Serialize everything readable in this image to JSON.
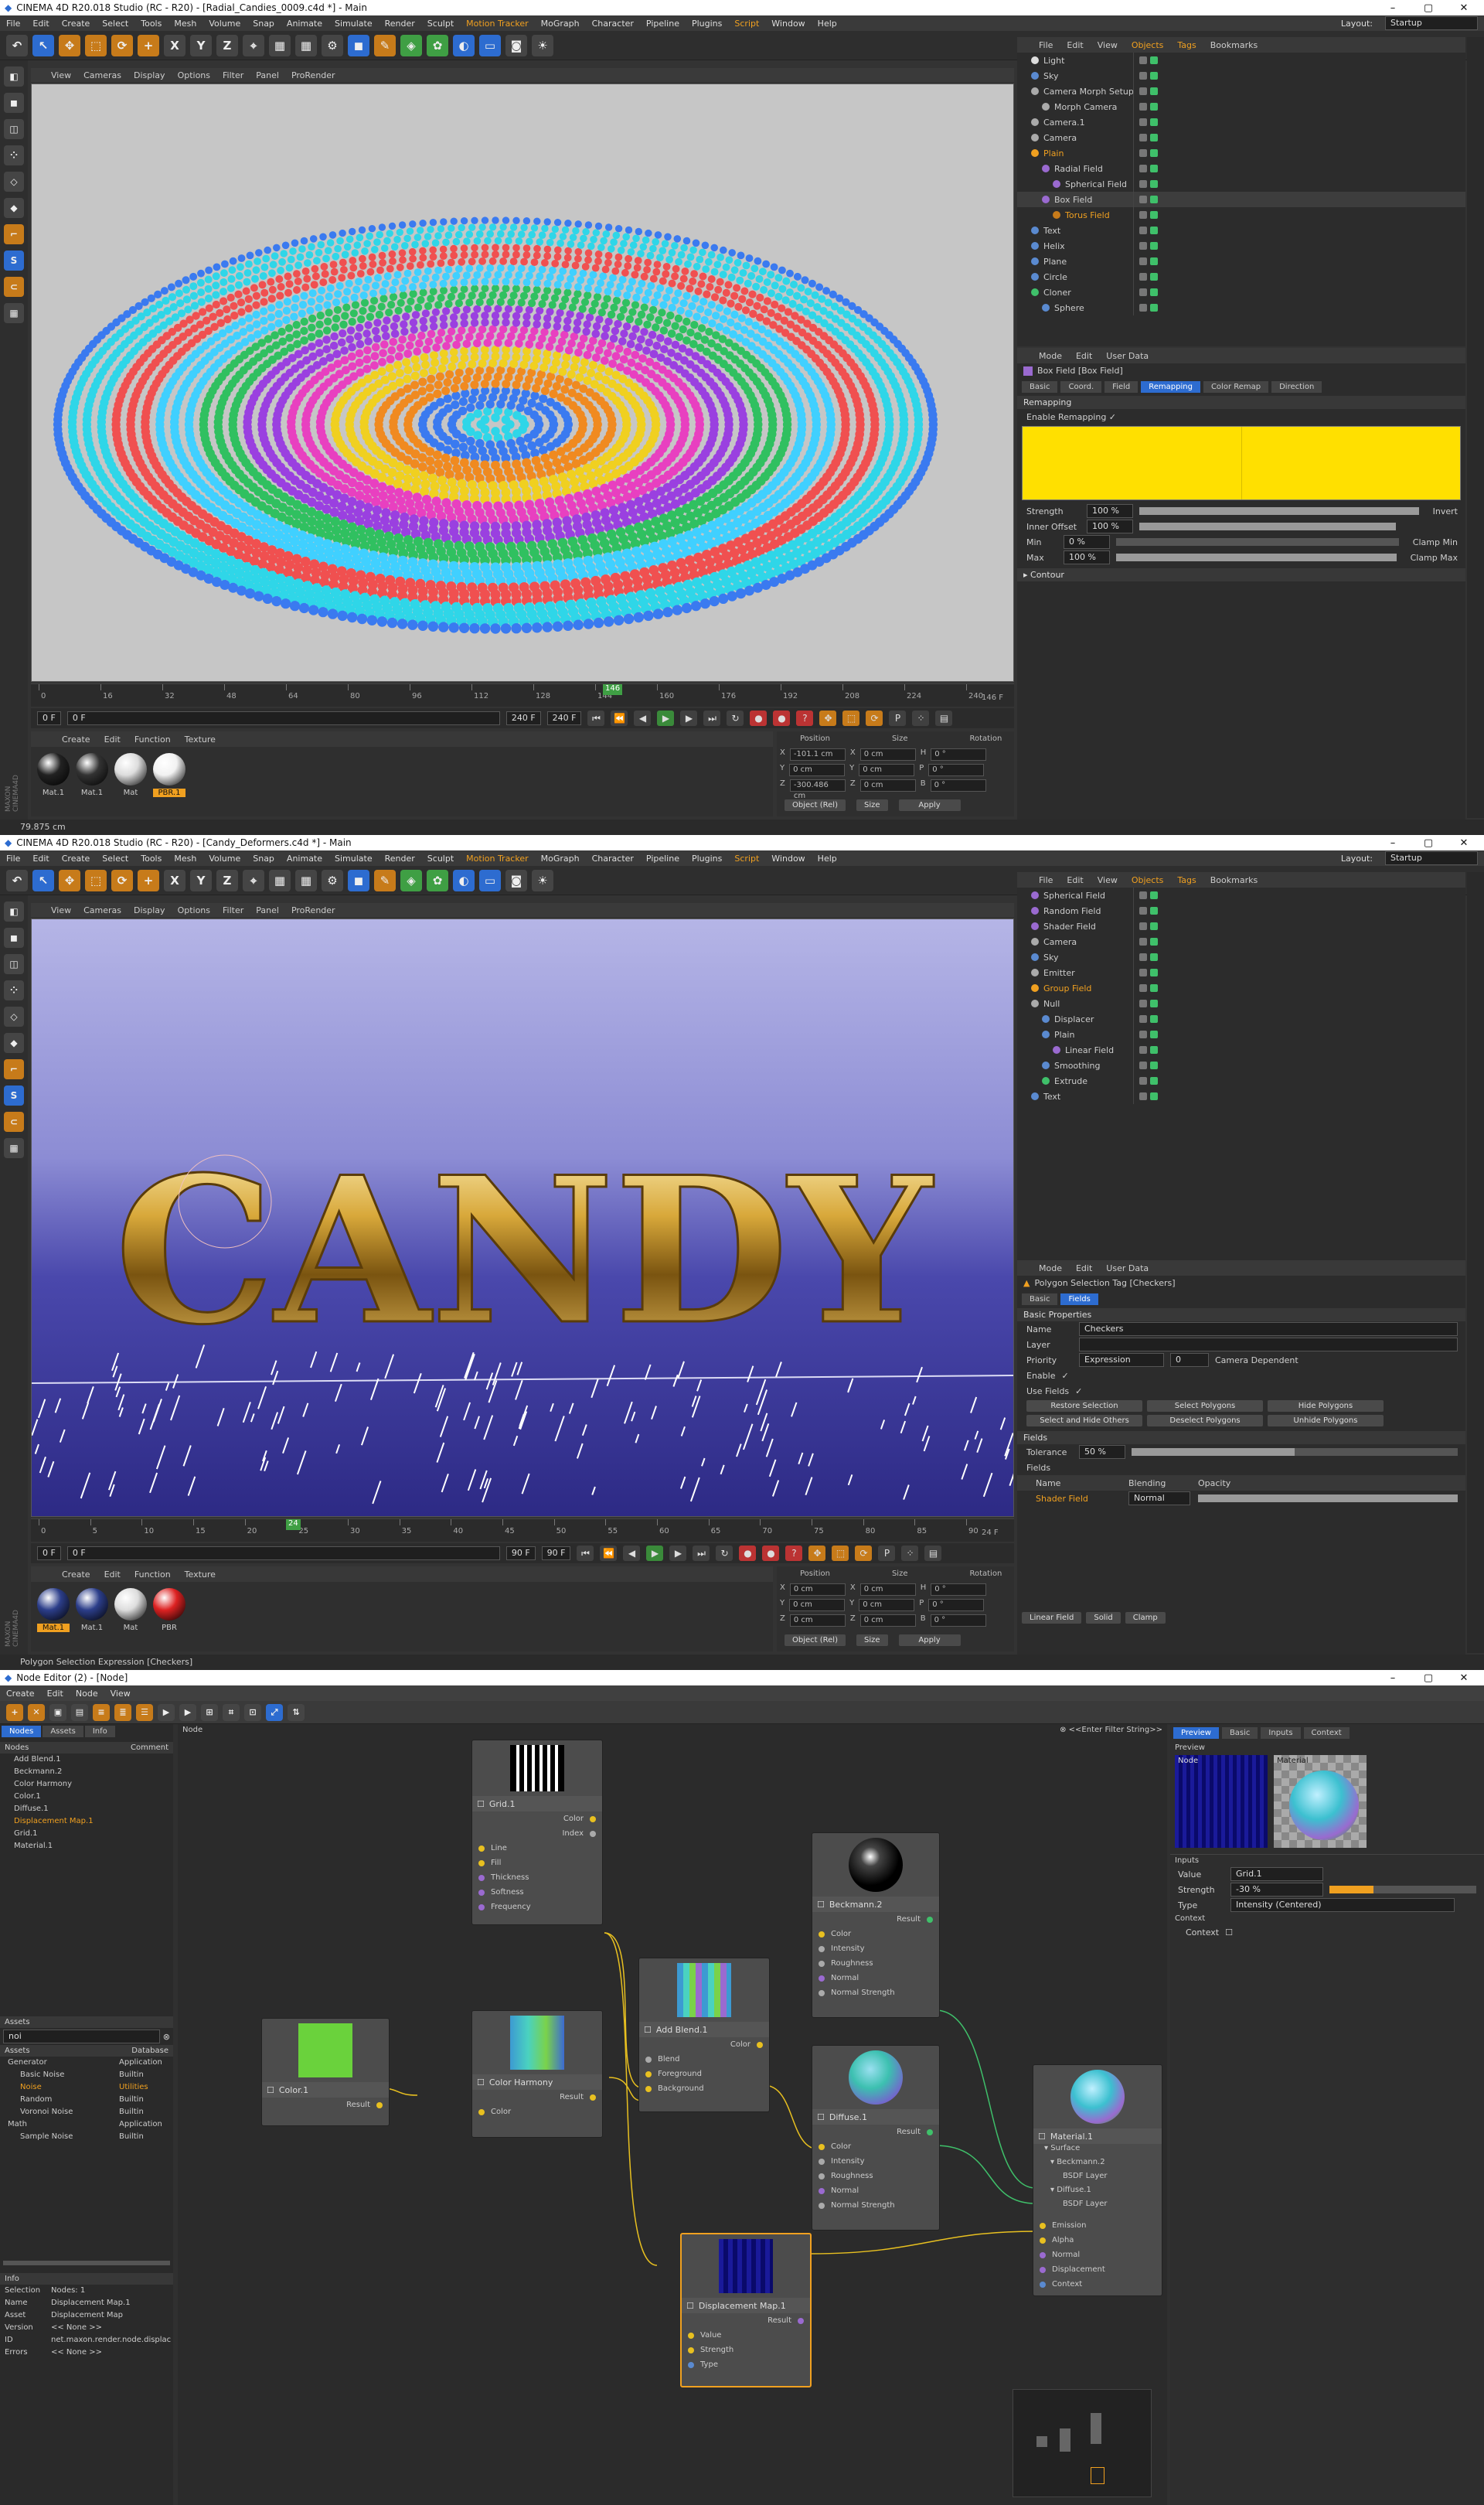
{
  "colors": {
    "accent": "#f0a020",
    "blue": "#2d6cd0",
    "bg": "#333333",
    "yellow_gradient": "#ffe000"
  },
  "win1": {
    "title": "CINEMA 4D R20.018 Studio (RC - R20) - [Radial_Candies_0009.c4d *] - Main",
    "layout_label": "Layout:",
    "layout_value": "Startup",
    "menu": [
      "File",
      "Edit",
      "Create",
      "Select",
      "Tools",
      "Mesh",
      "Volume",
      "Snap",
      "Animate",
      "Simulate",
      "Render",
      "Sculpt",
      "Motion Tracker",
      "MoGraph",
      "Character",
      "Pipeline",
      "Plugins",
      "Script",
      "Window",
      "Help"
    ],
    "vpmenu": [
      "View",
      "Cameras",
      "Display",
      "Options",
      "Filter",
      "Panel",
      "ProRender"
    ],
    "timeline_ticks": [
      "0",
      "16",
      "32",
      "48",
      "64",
      "80",
      "96",
      "112",
      "128",
      "144",
      "160",
      "176",
      "192",
      "208",
      "224",
      "240"
    ],
    "playhead": "146",
    "frame_end": "146 F",
    "frame_start": "0 F",
    "cur": "0 F",
    "max1": "240 F",
    "max2": "240 F",
    "mat_menu": [
      "Create",
      "Edit",
      "Function",
      "Texture"
    ],
    "materials": [
      {
        "label": "Mat.1",
        "color": "#222",
        "sel": false
      },
      {
        "label": "Mat.1",
        "color": "#333",
        "sel": false
      },
      {
        "label": "Mat",
        "color": "#ddd",
        "sel": false
      },
      {
        "label": "PBR.1",
        "color": "#f2f2f2",
        "sel": true
      }
    ],
    "coord_headers": [
      "Position",
      "Size",
      "Rotation"
    ],
    "coords": [
      [
        "X",
        "-101.1 cm",
        "X",
        "0 cm",
        "H",
        "0 °"
      ],
      [
        "Y",
        "0 cm",
        "Y",
        "0 cm",
        "P",
        "0 °"
      ],
      [
        "Z",
        "-300.486 cm",
        "Z",
        "0 cm",
        "B",
        "0 °"
      ]
    ],
    "coord_mode": "Object (Rel)",
    "coord_size": "Size",
    "apply": "Apply",
    "status": "79.875 cm",
    "obj_menu": [
      "File",
      "Edit",
      "View",
      "Objects",
      "Tags",
      "Bookmarks"
    ],
    "objects": [
      {
        "name": "Light",
        "color": "#ddd",
        "indent": 0
      },
      {
        "name": "Sky",
        "color": "#5a8ad0",
        "indent": 0
      },
      {
        "name": "Camera Morph Setup",
        "color": "#aaa",
        "indent": 0
      },
      {
        "name": "Morph Camera",
        "color": "#aaa",
        "indent": 1
      },
      {
        "name": "Camera.1",
        "color": "#aaa",
        "indent": 0
      },
      {
        "name": "Camera",
        "color": "#aaa",
        "indent": 0
      },
      {
        "name": "Plain",
        "color": "#f0a020",
        "indent": 0,
        "hl": true
      },
      {
        "name": "Radial Field",
        "color": "#9a6ad0",
        "indent": 1
      },
      {
        "name": "Spherical Field",
        "color": "#9a6ad0",
        "indent": 2
      },
      {
        "name": "Box Field",
        "color": "#9a6ad0",
        "indent": 1,
        "hl2": true
      },
      {
        "name": "Torus Field",
        "color": "#c77b1a",
        "indent": 2,
        "hl": true
      },
      {
        "name": "Text",
        "color": "#5a8ad0",
        "indent": 0
      },
      {
        "name": "Helix",
        "color": "#5a8ad0",
        "indent": 0
      },
      {
        "name": "Plane",
        "color": "#5a8ad0",
        "indent": 0
      },
      {
        "name": "Circle",
        "color": "#5a8ad0",
        "indent": 0
      },
      {
        "name": "Cloner",
        "color": "#3fc06a",
        "indent": 0
      },
      {
        "name": "Sphere",
        "color": "#5a8ad0",
        "indent": 1
      }
    ],
    "attr_menu": [
      "Mode",
      "Edit",
      "User Data"
    ],
    "attr_title": "Box Field [Box Field]",
    "attr_tabs": [
      "Basic",
      "Coord.",
      "Field",
      "Remapping",
      "Color Remap",
      "Direction"
    ],
    "attr_tab_on": 3,
    "section": "Remapping",
    "enable_remap": "Enable Remapping ✓",
    "strength_label": "Strength",
    "strength_val": "100 %",
    "invert": "Invert",
    "inner_label": "Inner Offset",
    "inner_val": "100 %",
    "min_label": "Min",
    "min_val": "0 %",
    "clampmin": "Clamp Min",
    "max_label": "Max",
    "max_val": "100 %",
    "clampmax": "Clamp Max",
    "contour": "▸ Contour"
  },
  "win2": {
    "title": "CINEMA 4D R20.018 Studio (RC - R20) - [Candy_Deformers.c4d *] - Main",
    "layout_label": "Layout:",
    "layout_value": "Startup",
    "vp_text": "CANDY",
    "timeline_ticks": [
      "0",
      "5",
      "10",
      "15",
      "20",
      "25",
      "30",
      "35",
      "40",
      "45",
      "50",
      "55",
      "60",
      "65",
      "70",
      "75",
      "80",
      "85",
      "90"
    ],
    "playhead": "24",
    "frame_end": "24 F",
    "frame_start": "0 F",
    "cur": "0 F",
    "max1": "90 F",
    "max2": "90 F",
    "materials": [
      {
        "label": "Mat.1",
        "color": "#2c3e8a",
        "sel": true
      },
      {
        "label": "Mat.1",
        "color": "#2c3e8a",
        "sel": false
      },
      {
        "label": "Mat",
        "color": "#ddd",
        "sel": false
      },
      {
        "label": "PBR",
        "color": "#d22",
        "sel": false
      }
    ],
    "coords": [
      [
        "X",
        "0 cm",
        "X",
        "0 cm",
        "H",
        "0 °"
      ],
      [
        "Y",
        "0 cm",
        "Y",
        "0 cm",
        "P",
        "0 °"
      ],
      [
        "Z",
        "0 cm",
        "Z",
        "0 cm",
        "B",
        "0 °"
      ]
    ],
    "status": "Polygon Selection Expression [Checkers]",
    "objects": [
      {
        "name": "Spherical Field",
        "color": "#9a6ad0",
        "indent": 0
      },
      {
        "name": "Random Field",
        "color": "#9a6ad0",
        "indent": 0
      },
      {
        "name": "Shader Field",
        "color": "#9a6ad0",
        "indent": 0
      },
      {
        "name": "Camera",
        "color": "#aaa",
        "indent": 0
      },
      {
        "name": "Sky",
        "color": "#5a8ad0",
        "indent": 0
      },
      {
        "name": "Emitter",
        "color": "#aaa",
        "indent": 0
      },
      {
        "name": "Group Field",
        "color": "#f0a020",
        "indent": 0,
        "hl": true
      },
      {
        "name": "Null",
        "color": "#aaa",
        "indent": 0
      },
      {
        "name": "Displacer",
        "color": "#5a8ad0",
        "indent": 1
      },
      {
        "name": "Plain",
        "color": "#5a8ad0",
        "indent": 1
      },
      {
        "name": "Linear Field",
        "color": "#9a6ad0",
        "indent": 2
      },
      {
        "name": "Smoothing",
        "color": "#5a8ad0",
        "indent": 1
      },
      {
        "name": "Extrude",
        "color": "#3fc06a",
        "indent": 1
      },
      {
        "name": "Text",
        "color": "#5a8ad0",
        "indent": 0
      }
    ],
    "attr_title": "Polygon Selection Tag [Checkers]",
    "attr_tabs": [
      "Basic",
      "Fields"
    ],
    "section": "Basic Properties",
    "name_label": "Name",
    "name_val": "Checkers",
    "layer_label": "Layer",
    "priority_label": "Priority",
    "priority_val": "Expression",
    "priority_num": "0",
    "cam_dep": "Camera Dependent",
    "enable_label": "Enable",
    "use_fields": "Use Fields",
    "buttons1": [
      "Restore Selection",
      "Select Polygons",
      "Hide Polygons"
    ],
    "buttons2": [
      "Select and Hide Others",
      "Deselect Polygons",
      "Unhide Polygons"
    ],
    "fields_section": "Fields",
    "tolerance_label": "Tolerance",
    "tolerance_val": "50 %",
    "fields_label": "Fields",
    "fields_cols": [
      "Name",
      "Blending",
      "Opacity"
    ],
    "fields_row": {
      "name": "Shader Field",
      "blend": "Normal",
      "opacity": "100 %"
    },
    "layer_btns": [
      "Linear Field",
      "Solid",
      "Clamp"
    ]
  },
  "ne": {
    "title": "Node Editor (2) - [Node]",
    "menu": [
      "Create",
      "Edit",
      "Node",
      "View"
    ],
    "tabs": [
      "Nodes",
      "Assets",
      "Info"
    ],
    "nodes_header": [
      "Nodes",
      "Comment"
    ],
    "node_list": [
      "Add Blend.1",
      "Beckmann.2",
      "Color Harmony",
      "Color.1",
      "Diffuse.1",
      "Displacement Map.1",
      "Grid.1",
      "Material.1"
    ],
    "node_list_sel": 5,
    "breadcrumb": "Node",
    "filter_placeholder": "<<Enter Filter String>>",
    "assets_label": "Assets",
    "search_val": "noi",
    "assets_header": [
      "Assets",
      "Database"
    ],
    "assets": [
      {
        "name": "Generator",
        "db": "Application",
        "lvl": 0
      },
      {
        "name": "Basic Noise",
        "db": "Builtin",
        "lvl": 1
      },
      {
        "name": "Noise",
        "db": "Utilities",
        "lvl": 1,
        "hl": true
      },
      {
        "name": "Random",
        "db": "Builtin",
        "lvl": 1
      },
      {
        "name": "Voronoi Noise",
        "db": "Builtin",
        "lvl": 1
      },
      {
        "name": "Math",
        "db": "Application",
        "lvl": 0
      },
      {
        "name": "Sample Noise",
        "db": "Builtin",
        "lvl": 1
      }
    ],
    "info_label": "Info",
    "info": [
      [
        "Selection",
        "Nodes: 1"
      ],
      [
        "Name",
        "Displacement Map.1"
      ],
      [
        "Asset",
        "Displacement Map"
      ],
      [
        "Version",
        "<< None >>"
      ],
      [
        "ID",
        "net.maxon.render.node.displac"
      ],
      [
        "Errors",
        "<< None >>"
      ]
    ],
    "right_tabs": [
      "Preview",
      "Basic",
      "Inputs",
      "Context"
    ],
    "preview_label": "Preview",
    "preview_node": "Node",
    "preview_mat": "Material",
    "inputs_label": "Inputs",
    "inputs": [
      [
        "Value",
        "Grid.1"
      ],
      [
        "Strength",
        "-30 %"
      ],
      [
        "Type",
        "Intensity (Centered)"
      ]
    ],
    "context_label": "Context",
    "context_row": "Context",
    "nodes": {
      "grid": {
        "title": "Grid.1",
        "ports_out": [
          "Color",
          "Index"
        ],
        "ports_in": [
          "Line",
          "Fill",
          "Thickness",
          "Softness",
          "Frequency"
        ]
      },
      "color1": {
        "title": "Color.1",
        "ports_out": [
          "Result"
        ]
      },
      "harmony": {
        "title": "Color Harmony",
        "ports_out": [
          "Result"
        ],
        "ports_in": [
          "Color"
        ]
      },
      "addblend": {
        "title": "Add Blend.1",
        "ports_out": [
          "Color"
        ],
        "ports_in": [
          "Blend",
          "Foreground",
          "Background"
        ]
      },
      "beckmann": {
        "title": "Beckmann.2",
        "ports_out": [
          "Result"
        ],
        "ports_in": [
          "Color",
          "Intensity",
          "Roughness",
          "Normal",
          "Normal Strength"
        ]
      },
      "diffuse": {
        "title": "Diffuse.1",
        "ports_out": [
          "Result"
        ],
        "ports_in": [
          "Color",
          "Intensity",
          "Roughness",
          "Normal",
          "Normal Strength"
        ]
      },
      "disp": {
        "title": "Displacement Map.1",
        "ports_out": [
          "Result"
        ],
        "ports_in": [
          "Value",
          "Strength",
          "Type"
        ]
      },
      "material": {
        "title": "Material.1",
        "tree": [
          "▾ Surface",
          "▾ Beckmann.2",
          "BSDF Layer",
          "▾ Diffuse.1",
          "BSDF Layer"
        ],
        "ports_in": [
          "Emission",
          "Alpha",
          "Normal",
          "Displacement",
          "Context"
        ]
      }
    }
  }
}
